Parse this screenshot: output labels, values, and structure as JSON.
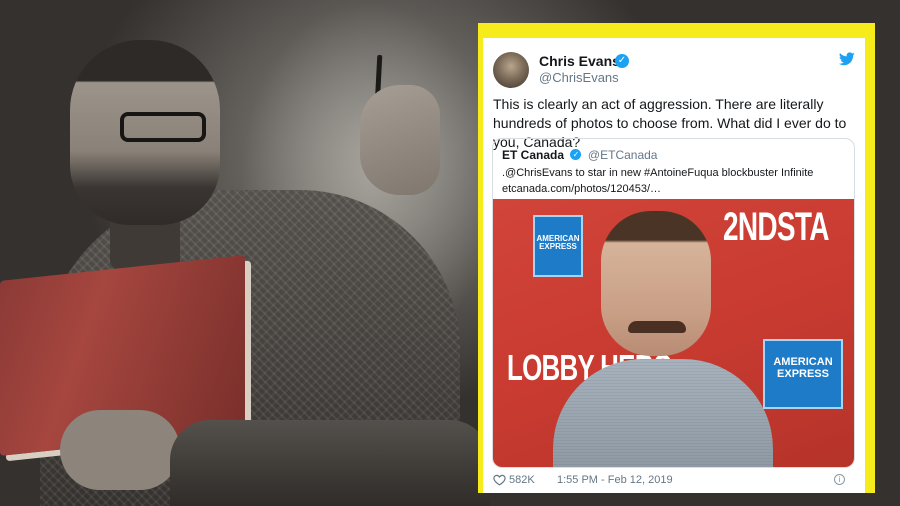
{
  "tweet": {
    "author_name": "Chris Evans",
    "author_handle": "@ChrisEvans",
    "text": "This is clearly an act of aggression. There are literally hundreds of photos to choose from. What did I ever do to you, Canada?",
    "verified_icon": "✓",
    "brand_icon": "twitter-bird",
    "like_count": "582K",
    "timestamp": "1:55 PM - Feb 12, 2019",
    "info_icon": "i"
  },
  "quoted_tweet": {
    "author_name": "ET Canada",
    "author_handle": "@ETCanada",
    "text": ".@ChrisEvans to star in new #AntoineFuqua blockbuster Infinite",
    "link": "etcanada.com/photos/120453/…",
    "image_signs": {
      "amex_top": "AMERICAN EXPRESS",
      "amex_bottom": "AMERICAN EXPRESS",
      "backdrop_top": "2NDSTA",
      "backdrop_left": "LOBBY HERO"
    }
  },
  "colors": {
    "frame": "#f7ec1b",
    "twitter_blue": "#1da1f2",
    "backdrop_red": "#c93b31"
  }
}
